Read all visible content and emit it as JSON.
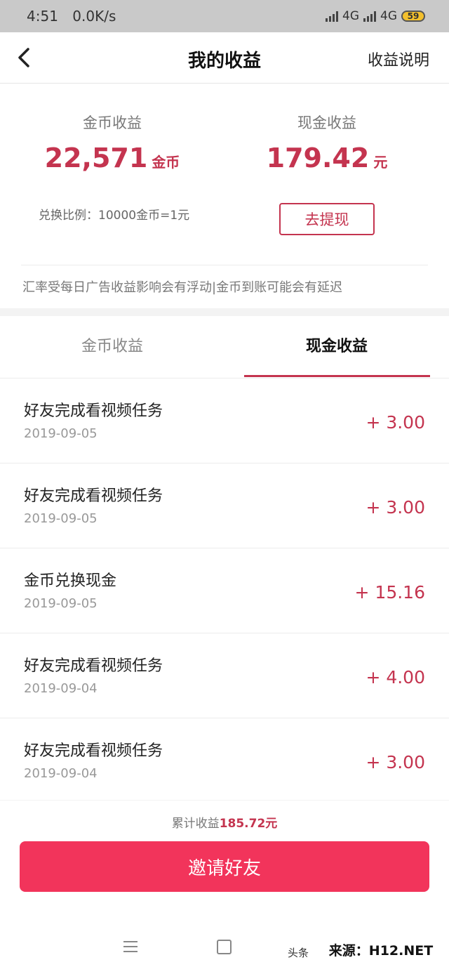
{
  "status_bar": {
    "time": "4:51",
    "net_speed": "0.0K/s",
    "net1": "4G",
    "net2": "4G",
    "battery": "59"
  },
  "header": {
    "title": "我的收益",
    "right_link": "收益说明"
  },
  "summary": {
    "coin_label": "金币收益",
    "coin_value": "22,571",
    "coin_unit": "金币",
    "cash_label": "现金收益",
    "cash_value": "179.42",
    "cash_unit": "元",
    "ratio": "兑换比例：10000金币=1元",
    "withdraw_button": "去提现",
    "notice": "汇率受每日广告收益影响会有浮动|金币到账可能会有延迟"
  },
  "tabs": [
    {
      "label": "金币收益",
      "active": false
    },
    {
      "label": "现金收益",
      "active": true
    }
  ],
  "records": [
    {
      "title": "好友完成看视频任务",
      "date": "2019-09-05",
      "amount": "+ 3.00"
    },
    {
      "title": "好友完成看视频任务",
      "date": "2019-09-05",
      "amount": "+ 3.00"
    },
    {
      "title": "金币兑换现金",
      "date": "2019-09-05",
      "amount": "+ 15.16"
    },
    {
      "title": "好友完成看视频任务",
      "date": "2019-09-04",
      "amount": "+ 4.00"
    },
    {
      "title": "好友完成看视频任务",
      "date": "2019-09-04",
      "amount": "+ 3.00"
    }
  ],
  "footer": {
    "total_label": "累计收益",
    "total_value": "185.72元",
    "invite_button": "邀请好友"
  },
  "watermark": {
    "small": "头条",
    "source": "来源：H12.NET"
  },
  "colors": {
    "accent": "#c4344f",
    "button": "#f2345b"
  }
}
